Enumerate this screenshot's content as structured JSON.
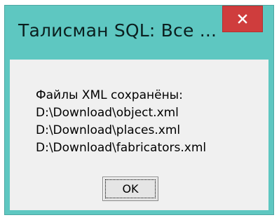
{
  "window": {
    "title": "Талисман SQL: Все ...",
    "close_icon": "close-icon",
    "close_color": "#cf3d3d",
    "frame_color": "#5ec7c1"
  },
  "message": {
    "lines": [
      "Файлы XML сохранёны:",
      "D:\\Download\\object.xml",
      "D:\\Download\\places.xml",
      "D:\\Download\\fabricators.xml"
    ]
  },
  "buttons": {
    "ok_label": "OK"
  }
}
